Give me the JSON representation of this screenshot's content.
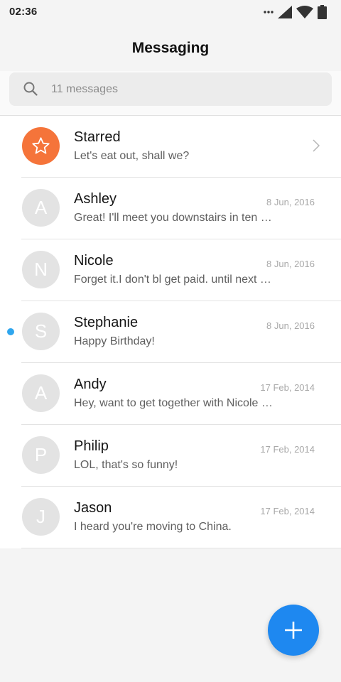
{
  "status_bar": {
    "time": "02:36",
    "icons": [
      "more-dots-icon",
      "cellular-signal-icon",
      "wifi-icon",
      "battery-icon"
    ]
  },
  "header": {
    "title": "Messaging"
  },
  "search": {
    "placeholder": "11 messages",
    "icon": "search-icon"
  },
  "conversations": [
    {
      "name": "Starred",
      "preview": "Let's eat out, shall we?",
      "date": "",
      "avatar": "star-icon",
      "avatar_color": "#f5743a",
      "unread": false,
      "has_chevron": true
    },
    {
      "name": "Ashley",
      "preview": "Great! I'll meet you downstairs in ten minutes.",
      "date": "8 Jun, 2016",
      "avatar": "A",
      "unread": false
    },
    {
      "name": "Nicole",
      "preview": "Forget it.I don't bl get paid. until next Friday.",
      "date": "8 Jun, 2016",
      "avatar": "N",
      "unread": false
    },
    {
      "name": "Stephanie",
      "preview": "Happy Birthday!",
      "date": "8 Jun, 2016",
      "avatar": "S",
      "unread": true
    },
    {
      "name": "Andy",
      "preview": "Hey, want to get together with Nicole tonight?",
      "date": "17 Feb, 2014",
      "avatar": "A",
      "unread": false
    },
    {
      "name": "Philip",
      "preview": "LOL, that's so funny!",
      "date": "17 Feb, 2014",
      "avatar": "P",
      "unread": false
    },
    {
      "name": "Jason",
      "preview": "I heard you're moving to China.",
      "date": "17 Feb, 2014",
      "avatar": "J",
      "unread": false
    }
  ],
  "fab": {
    "icon": "plus-icon",
    "color": "#1e88f0"
  },
  "colors": {
    "background": "#f4f4f4",
    "unread_dot": "#2fa6ee",
    "avatar_default": "#e3e3e3"
  }
}
